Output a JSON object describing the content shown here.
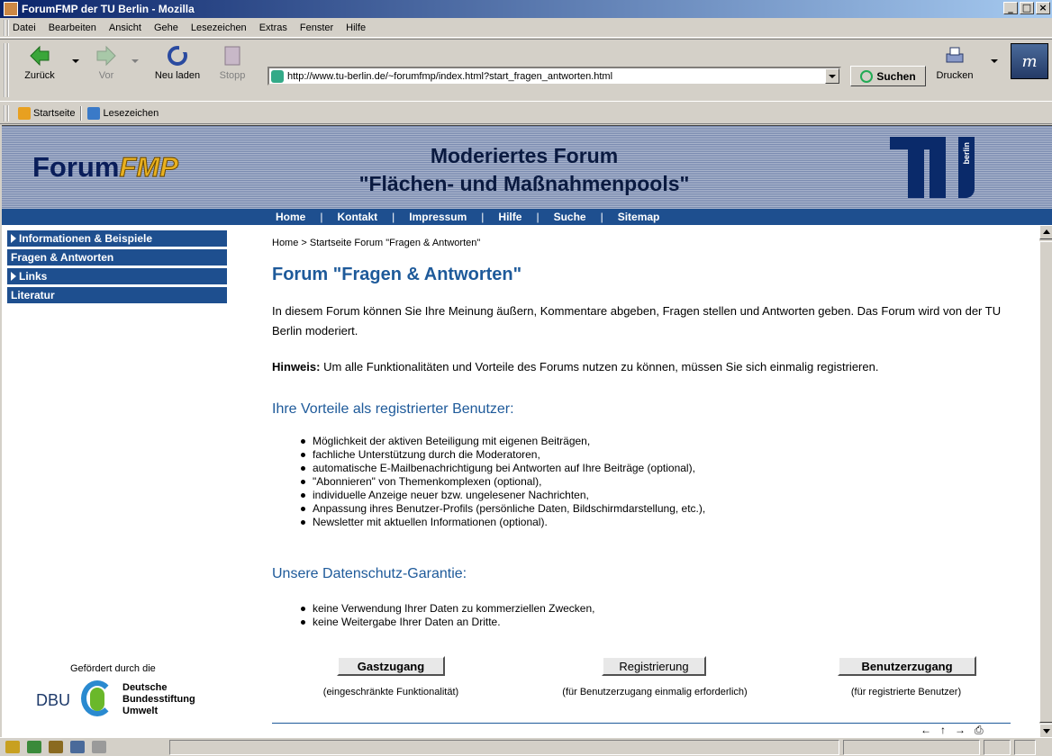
{
  "window": {
    "title": "ForumFMP der TU Berlin - Mozilla",
    "controls": [
      "_",
      "□",
      "×"
    ]
  },
  "menu": [
    "Datei",
    "Bearbeiten",
    "Ansicht",
    "Gehe",
    "Lesezeichen",
    "Extras",
    "Fenster",
    "Hilfe"
  ],
  "toolbar": {
    "back": "Zurück",
    "forward": "Vor",
    "reload": "Neu laden",
    "stop": "Stopp",
    "url": "http://www.tu-berlin.de/~forumfmp/index.html?start_fragen_antworten.html",
    "search": "Suchen",
    "print": "Drucken"
  },
  "personal": {
    "home": "Startseite",
    "bookmarks": "Lesezeichen"
  },
  "banner": {
    "logo_a": "Forum",
    "logo_b": "FMP",
    "title_line1": "Moderiertes Forum",
    "title_line2": "\"Flächen- und Maßnahmenpools\"",
    "tu_word": "berlin"
  },
  "topnav": [
    "Home",
    "Kontakt",
    "Impressum",
    "Hilfe",
    "Suche",
    "Sitemap"
  ],
  "topnav_sep": "|",
  "sidenav": [
    {
      "label": "Informationen & Beispiele",
      "arrow": true
    },
    {
      "label": "Fragen & Antworten",
      "arrow": false
    },
    {
      "label": "Links",
      "arrow": true
    },
    {
      "label": "Literatur",
      "arrow": false
    }
  ],
  "content": {
    "breadcrumb": "Home  >  Startseite Forum \"Fragen & Antworten\"",
    "heading": "Forum \"Fragen & Antworten\"",
    "intro": "In diesem Forum können Sie Ihre Meinung äußern, Kommentare abgeben, Fragen stellen und Antworten geben. Das Forum wird von der TU Berlin moderiert.",
    "hint_label": "Hinweis:",
    "hint_text": " Um alle Funktionalitäten und Vorteile des Forums nutzen zu können, müssen Sie sich einmalig registrieren.",
    "vorteile_heading": "Ihre Vorteile als registrierter Benutzer:",
    "vorteile": [
      "Möglichkeit der aktiven Beteiligung mit eigenen Beiträgen,",
      "fachliche Unterstützung durch die Moderatoren,",
      "automatische E-Mailbenachrichtigung bei Antworten auf Ihre Beiträge (optional),",
      "\"Abonnieren\" von Themenkomplexen (optional),",
      "individuelle Anzeige neuer bzw. ungelesener Nachrichten,",
      "Anpassung ihres Benutzer-Profils (persönliche Daten, Bildschirmdarstellung, etc.),",
      "Newsletter mit aktuellen Informationen (optional)."
    ],
    "datenschutz_heading": "Unsere Datenschutz-Garantie:",
    "datenschutz": [
      "keine Verwendung Ihrer Daten zu kommerziellen Zwecken,",
      "keine Weitergabe Ihrer Daten an Dritte."
    ],
    "buttons": [
      {
        "label": "Gastzugang",
        "caption": "(eingeschränkte Funktionalität)"
      },
      {
        "label": "Registrierung",
        "caption": "(für Benutzerzugang einmalig erforderlich)"
      },
      {
        "label": "Benutzerzugang",
        "caption": "(für registrierte Benutzer)"
      }
    ]
  },
  "sponsor": {
    "label": "Gefördert durch die",
    "abbr": "DBU",
    "name_line1": "Deutsche",
    "name_line2": "Bundesstiftung",
    "name_line3": "Umwelt"
  },
  "pager_icons": [
    "←",
    "↑",
    "→",
    "print-icon"
  ],
  "colors": {
    "nav_blue": "#1e4f8f",
    "heading_blue": "#1e5a9a",
    "titlebar": "#0a246a"
  }
}
